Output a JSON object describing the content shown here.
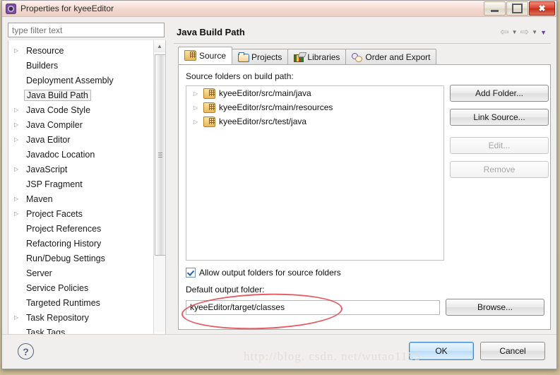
{
  "window": {
    "title": "Properties for kyeeEditor",
    "icon": "gear-icon",
    "minimize_label": "Minimize",
    "maximize_label": "Maximize",
    "close_label": "Close"
  },
  "sidebar": {
    "filter_placeholder": "type filter text",
    "filter_value": "",
    "items": [
      {
        "label": "Resource",
        "expandable": true,
        "selected": false
      },
      {
        "label": "Builders",
        "expandable": false,
        "selected": false
      },
      {
        "label": "Deployment Assembly",
        "expandable": false,
        "selected": false
      },
      {
        "label": "Java Build Path",
        "expandable": false,
        "selected": true
      },
      {
        "label": "Java Code Style",
        "expandable": true,
        "selected": false
      },
      {
        "label": "Java Compiler",
        "expandable": true,
        "selected": false
      },
      {
        "label": "Java Editor",
        "expandable": true,
        "selected": false
      },
      {
        "label": "Javadoc Location",
        "expandable": false,
        "selected": false
      },
      {
        "label": "JavaScript",
        "expandable": true,
        "selected": false
      },
      {
        "label": "JSP Fragment",
        "expandable": false,
        "selected": false
      },
      {
        "label": "Maven",
        "expandable": true,
        "selected": false
      },
      {
        "label": "Project Facets",
        "expandable": true,
        "selected": false
      },
      {
        "label": "Project References",
        "expandable": false,
        "selected": false
      },
      {
        "label": "Refactoring History",
        "expandable": false,
        "selected": false
      },
      {
        "label": "Run/Debug Settings",
        "expandable": false,
        "selected": false
      },
      {
        "label": "Server",
        "expandable": false,
        "selected": false
      },
      {
        "label": "Service Policies",
        "expandable": false,
        "selected": false
      },
      {
        "label": "Targeted Runtimes",
        "expandable": false,
        "selected": false
      },
      {
        "label": "Task Repository",
        "expandable": true,
        "selected": false
      },
      {
        "label": "Task Tags",
        "expandable": false,
        "selected": false
      }
    ]
  },
  "page": {
    "title": "Java Build Path",
    "nav": {
      "back_icon": "arrow-left-icon",
      "back_menu_icon": "chevron-down-icon",
      "forward_icon": "arrow-right-icon",
      "forward_menu_icon": "chevron-down-icon",
      "view_menu_icon": "chevron-down-filled-icon"
    }
  },
  "tabs": [
    {
      "label": "Source",
      "icon": "source-folder-icon",
      "active": true
    },
    {
      "label": "Projects",
      "icon": "open-folder-icon",
      "active": false
    },
    {
      "label": "Libraries",
      "icon": "books-icon",
      "active": false
    },
    {
      "label": "Order and Export",
      "icon": "order-export-icon",
      "active": false
    }
  ],
  "source_tab": {
    "list_label": "Source folders on build path:",
    "folders": [
      {
        "label": "kyeeEditor/src/main/java",
        "icon": "source-folder-icon"
      },
      {
        "label": "kyeeEditor/src/main/resources",
        "icon": "source-folder-icon"
      },
      {
        "label": "kyeeEditor/src/test/java",
        "icon": "source-folder-icon"
      }
    ],
    "buttons": [
      {
        "label": "Add Folder...",
        "enabled": true
      },
      {
        "label": "Link Source...",
        "enabled": true
      },
      {
        "label": "Edit...",
        "enabled": false
      },
      {
        "label": "Remove",
        "enabled": false
      }
    ],
    "allow_output_folders": {
      "label": "Allow output folders for source folders",
      "checked": true
    },
    "default_output_folder": {
      "label": "Default output folder:",
      "value": "kyeeEditor/target/classes",
      "browse_label": "Browse..."
    }
  },
  "footer": {
    "help_icon": "question-mark-icon",
    "ok_label": "OK",
    "cancel_label": "Cancel"
  },
  "watermark": "http://blog. csdn. net/wutao1155",
  "colors": {
    "accent": "#3d8ac7",
    "annotation": "#e2414a",
    "title_gradient": "#f2d7cd",
    "close_button": "#d9402a"
  }
}
